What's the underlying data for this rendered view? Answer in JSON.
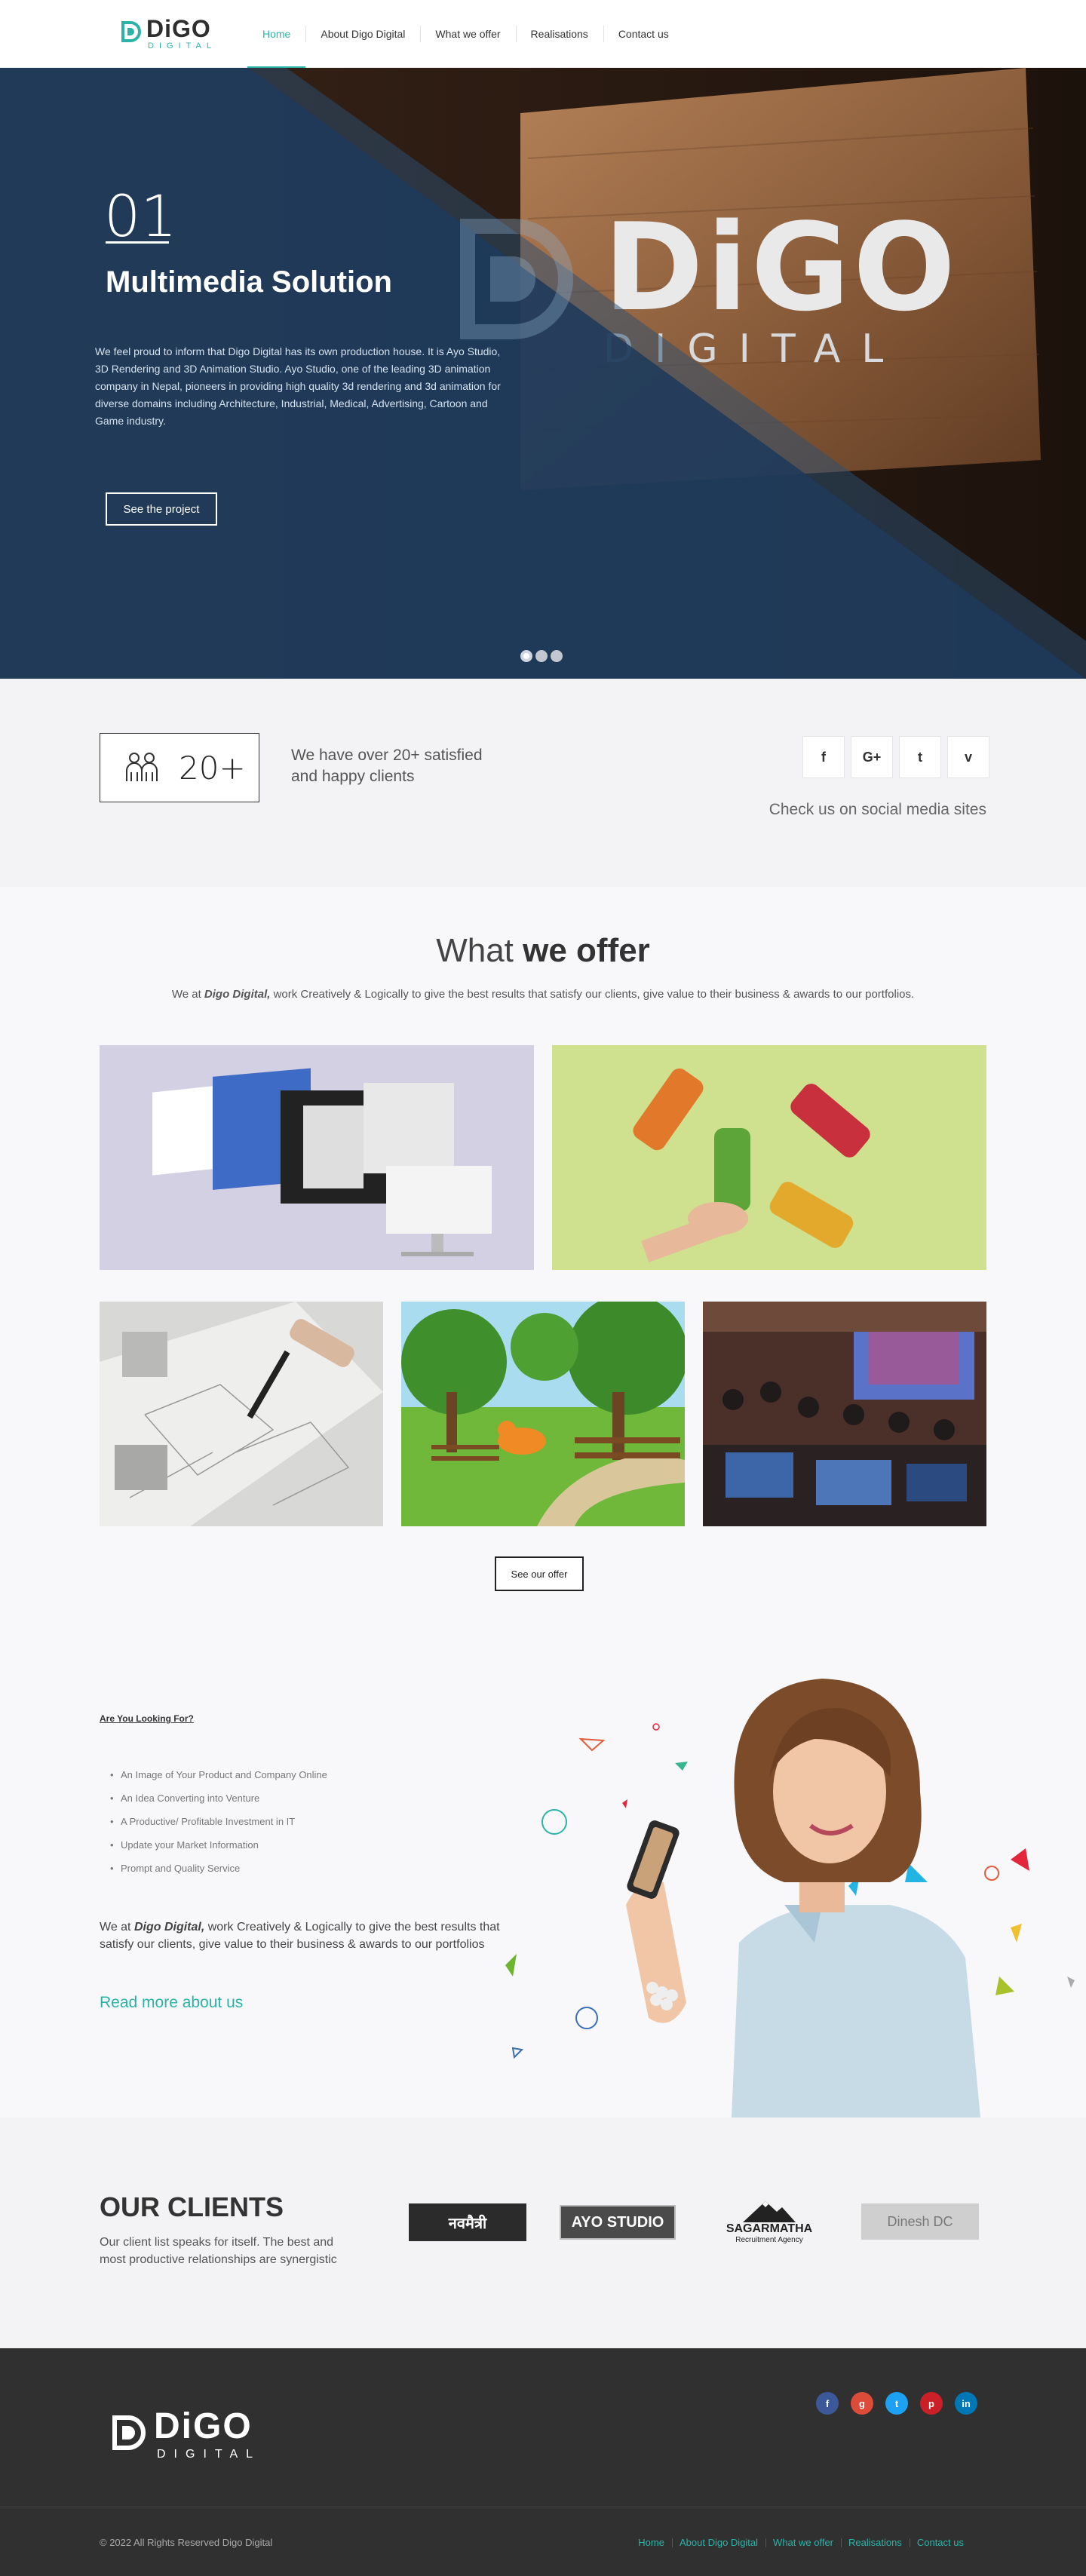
{
  "brand": {
    "word": "DiGO",
    "sub": "DIGITAL"
  },
  "nav": {
    "items": [
      "Home",
      "About Digo Digital",
      "What we offer",
      "Realisations",
      "Contact us"
    ],
    "active": "Home"
  },
  "hero": {
    "number": "01",
    "title": "Multimedia Solution",
    "description": "We feel proud to inform that Digo Digital has its own production house. It is Ayo Studio, 3D Rendering and 3D Animation Studio. Ayo Studio, one of the leading 3D animation company in Nepal, pioneers in providing high quality 3d rendering and 3d animation for diverse domains including Architecture, Industrial, Medical, Advertising, Cartoon and Game industry.",
    "button": "See the project",
    "sign_word": "DiGO",
    "sign_sub": "DIGITAL",
    "slides": 3,
    "active_slide": 1
  },
  "stats": {
    "count": "20+",
    "text": "We have over 20+ satisfied and happy clients",
    "social_caption": "Check us on social media sites",
    "socials": [
      {
        "name": "facebook-icon",
        "glyph": "f"
      },
      {
        "name": "google-plus-icon",
        "glyph": "G+"
      },
      {
        "name": "twitter-icon",
        "glyph": "t"
      },
      {
        "name": "vimeo-icon",
        "glyph": "v"
      }
    ]
  },
  "offer": {
    "title_light": "What ",
    "title_bold": "we offer",
    "subtitle_pre": "We at ",
    "subtitle_brand": "Digo Digital,",
    "subtitle_post": " work Creatively & Logically to give the best results that satisfy our clients, give value to their business & awards to our portfolios.",
    "button": "See our offer"
  },
  "looking": {
    "title": "Are You Looking For?",
    "items": [
      "An Image of Your Product and Company Online",
      "An Idea Converting into Venture",
      "A Productive/ Profitable Investment in IT",
      "Update your Market Information",
      "Prompt and Quality Service"
    ],
    "body_pre": "We at ",
    "body_brand": "Digo Digital,",
    "body_post": " work Creatively & Logically to give the best results that satisfy our clients, give value to their business & awards to our portfolios",
    "link": "Read more about us"
  },
  "clients": {
    "title_light": "OUR ",
    "title_bold": "CLIENTS",
    "text": "Our client list speaks for itself. The best and most productive relationships are synergistic",
    "logos": [
      {
        "name": "client-logo-navamaitri",
        "label": "नवमैत्री"
      },
      {
        "name": "client-logo-ayo-studio",
        "label": "AYO STUDIO"
      },
      {
        "name": "client-logo-sagarmatha",
        "label": "SAGARMATHA",
        "sub": "Recruitment Agency"
      },
      {
        "name": "client-logo-dinesh-dc",
        "label": "Dinesh DC"
      }
    ]
  },
  "footer": {
    "word": "DiGO",
    "sub": "DIGITAL",
    "copyright": "© 2022 All Rights Reserved Digo Digital",
    "nav": [
      "Home",
      "About Digo Digital",
      "What we offer",
      "Realisations",
      "Contact us"
    ],
    "socials": [
      {
        "name": "facebook-icon",
        "glyph": "f",
        "color": "#3b5998"
      },
      {
        "name": "google-plus-icon",
        "glyph": "g",
        "color": "#dd4b39"
      },
      {
        "name": "twitter-icon",
        "glyph": "t",
        "color": "#1da1f2"
      },
      {
        "name": "pinterest-icon",
        "glyph": "p",
        "color": "#cb2027"
      },
      {
        "name": "linkedin-icon",
        "glyph": "in",
        "color": "#0077b5"
      }
    ]
  },
  "colors": {
    "accent": "#2bb3a8",
    "hero_blue": "#1f3c5c",
    "footer": "#303030"
  }
}
